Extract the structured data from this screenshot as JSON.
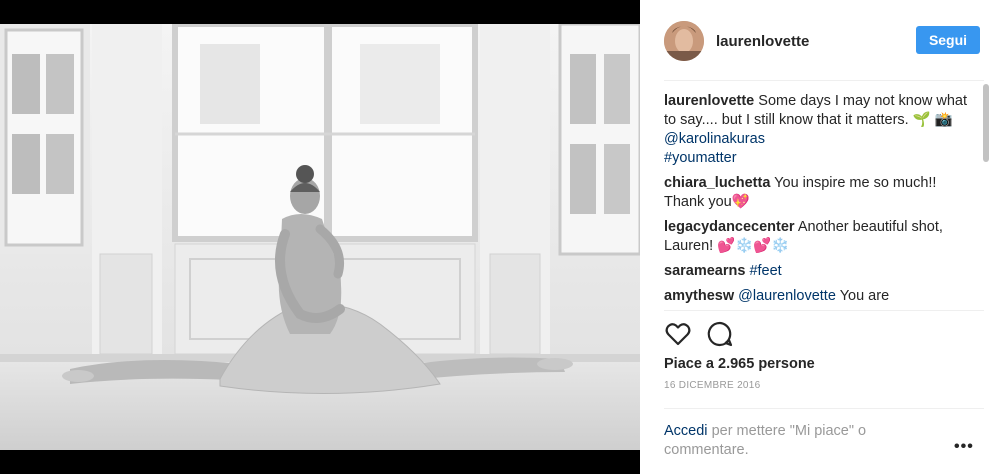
{
  "post": {
    "username": "laurenlovette",
    "follow_label": "Segui",
    "caption_username": "laurenlovette",
    "caption_text": "Some days I may not know what to say.... but I still know that it matters. 🌱 📸",
    "caption_mention": "@karolinakuras",
    "caption_hashtag": "#youmatter",
    "likes_text": "Piace a 2.965 persone",
    "date": "16 DICEMBRE 2016"
  },
  "comments": [
    {
      "user": "chiara_luchetta",
      "text": "You inspire me so much!! Thank you💖",
      "link": ""
    },
    {
      "user": "legacydancecenter",
      "text": "Another beautiful shot, Lauren! 💕❄️💕❄️",
      "link": ""
    },
    {
      "user": "saramearns",
      "text": "",
      "link": "#feet"
    },
    {
      "user": "amythesw",
      "text": "You are",
      "link": "@laurenlovette"
    }
  ],
  "login": {
    "link_text": "Accedi",
    "rest_text": "per mettere \"Mi piace\" o commentare."
  },
  "icons": {
    "like": "heart-icon",
    "comment": "comment-icon",
    "more": "more-options-icon"
  },
  "colors": {
    "follow_button": "#3897f0",
    "link": "#003569",
    "meta_gray": "#999999"
  }
}
